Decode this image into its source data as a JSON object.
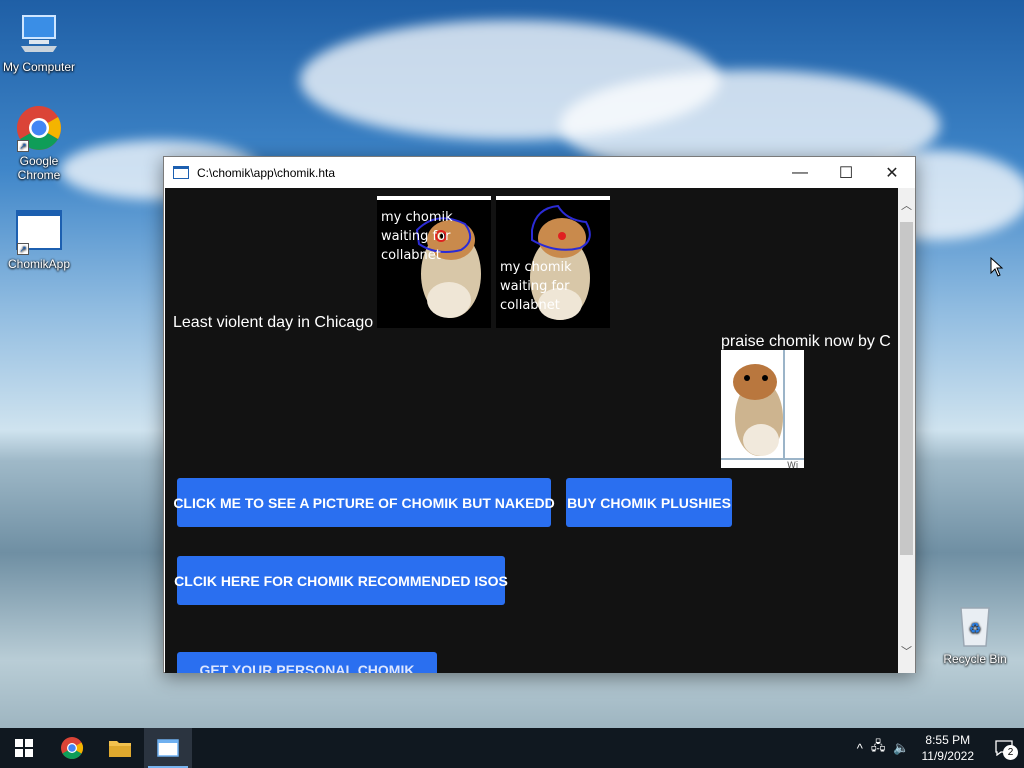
{
  "desktop": {
    "icons": [
      {
        "label": "My Computer"
      },
      {
        "label": "Google Chrome"
      },
      {
        "label": "ChomikApp"
      },
      {
        "label": "Recycle Bin"
      }
    ]
  },
  "window": {
    "title": "C:\\chomik\\app\\chomik.hta",
    "controls": {
      "minimize": "—",
      "maximize": "☐",
      "close": "✕"
    }
  },
  "content": {
    "headline": "Least violent day in Chicago",
    "cards": [
      {
        "caption_line1": "my chomik",
        "caption_line2": "waiting for",
        "caption_line3": "collabnet"
      },
      {
        "caption_line1": "my chomik",
        "caption_line2": "waiting for",
        "caption_line3": "collabnet"
      }
    ],
    "praise_text": "praise chomik now by C",
    "praise_img_watermark": "Wi",
    "buttons": {
      "naked": "CLICK ME TO SEE A PICTURE OF CHOMIK BUT NAKEDD",
      "plushies": "BUY CHOMIK PLUSHIES",
      "isos": "CLCIK HERE FOR CHOMIK RECOMMENDED ISOS",
      "partial": "GET YOUR PERSONAL CHOMIK"
    }
  },
  "scrollbar": {
    "up": "︿",
    "down": "﹀"
  },
  "taskbar": {
    "time": "8:55 PM",
    "date": "11/9/2022",
    "notification_count": "2",
    "tray_chevron": "^"
  },
  "colors": {
    "button_blue": "#2a6ff0",
    "content_bg": "#121212",
    "taskbar_bg": "#101820"
  }
}
